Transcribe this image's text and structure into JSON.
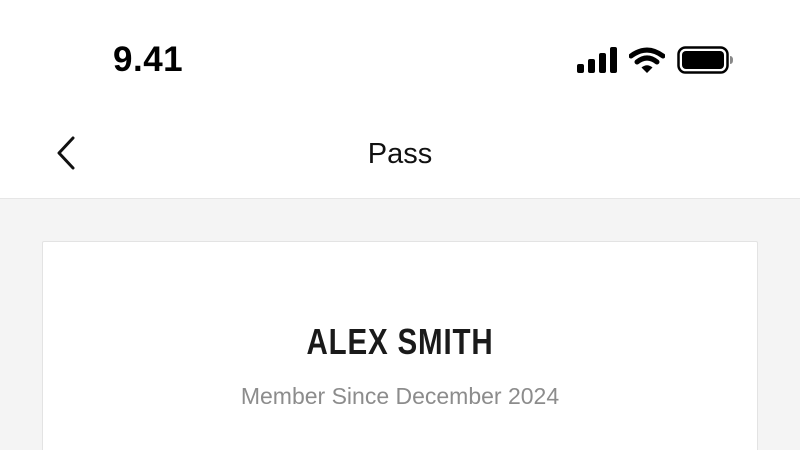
{
  "status_bar": {
    "time": "9.41",
    "icons": [
      "cellular-signal-icon",
      "wifi-icon",
      "battery-icon"
    ]
  },
  "nav": {
    "back_icon": "chevron-left-icon",
    "title": "Pass"
  },
  "pass_card": {
    "member_name": "ALEX SMITH",
    "member_since": "Member Since December 2024"
  },
  "colors": {
    "background": "#ffffff",
    "content_background": "#f4f4f4",
    "card_border": "#e3e3e3",
    "secondary_text": "#8c8c8c",
    "primary_text": "#111111"
  }
}
